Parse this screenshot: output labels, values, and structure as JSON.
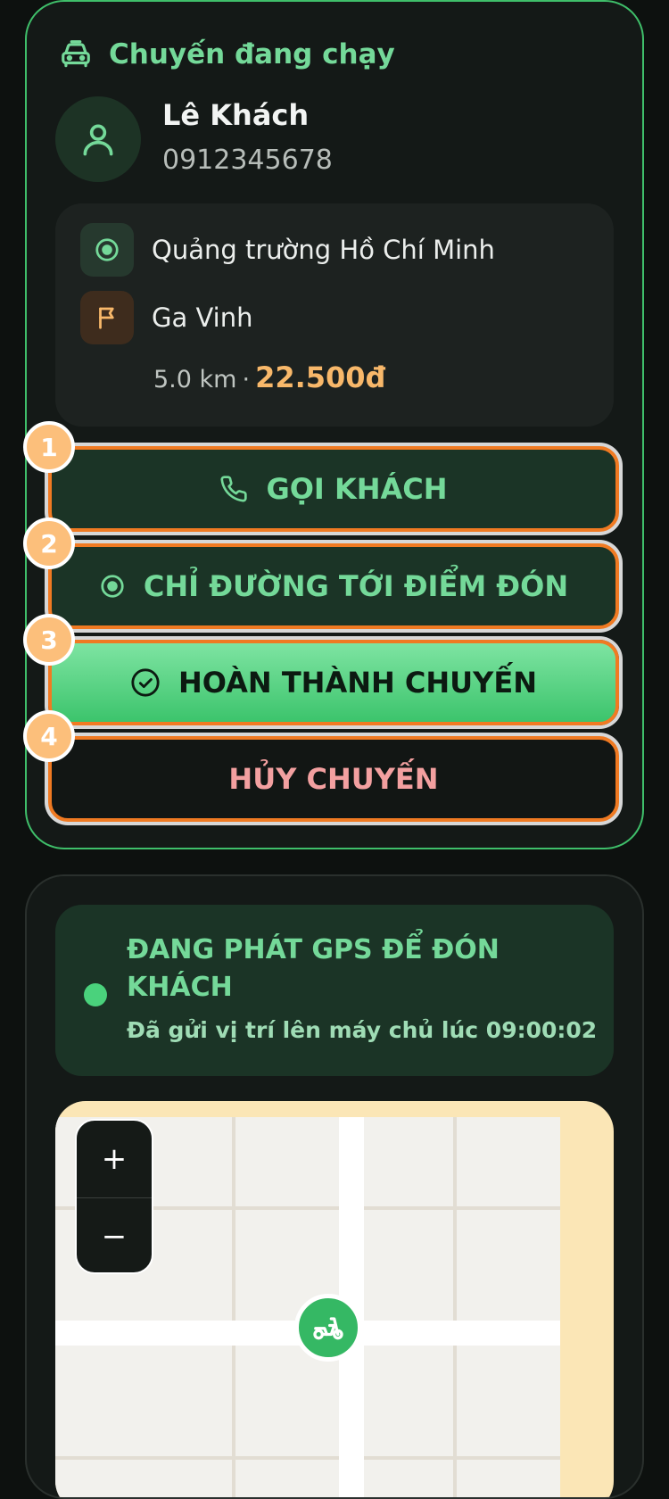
{
  "trip": {
    "title": "Chuyến đang chạy",
    "customer": {
      "name": "Lê Khách",
      "phone": "0912345678"
    },
    "pickup": "Quảng trường Hồ Chí Minh",
    "dropoff": "Ga Vinh",
    "distance": "5.0 km",
    "separator": "·",
    "fare": "22.500đ",
    "actions": {
      "call": "GỌI KHÁCH",
      "navigate": "CHỈ ĐƯỜNG TỚI ĐIỂM ĐÓN",
      "complete": "HOÀN THÀNH CHUYẾN",
      "cancel": "HỦY CHUYẾN"
    },
    "badges": [
      "1",
      "2",
      "3",
      "4"
    ]
  },
  "gps": {
    "title": "ĐANG PHÁT GPS ĐỂ ĐÓN KHÁCH",
    "subtitle": "Đã gửi vị trí lên máy chủ lúc 09:00:02"
  },
  "map": {
    "zoom_in": "+",
    "zoom_out": "−"
  },
  "colors": {
    "accent_green": "#74d999",
    "orange_highlight": "#f07a22",
    "fare_orange": "#f8b86a",
    "cancel_red": "#f3a0a0"
  }
}
